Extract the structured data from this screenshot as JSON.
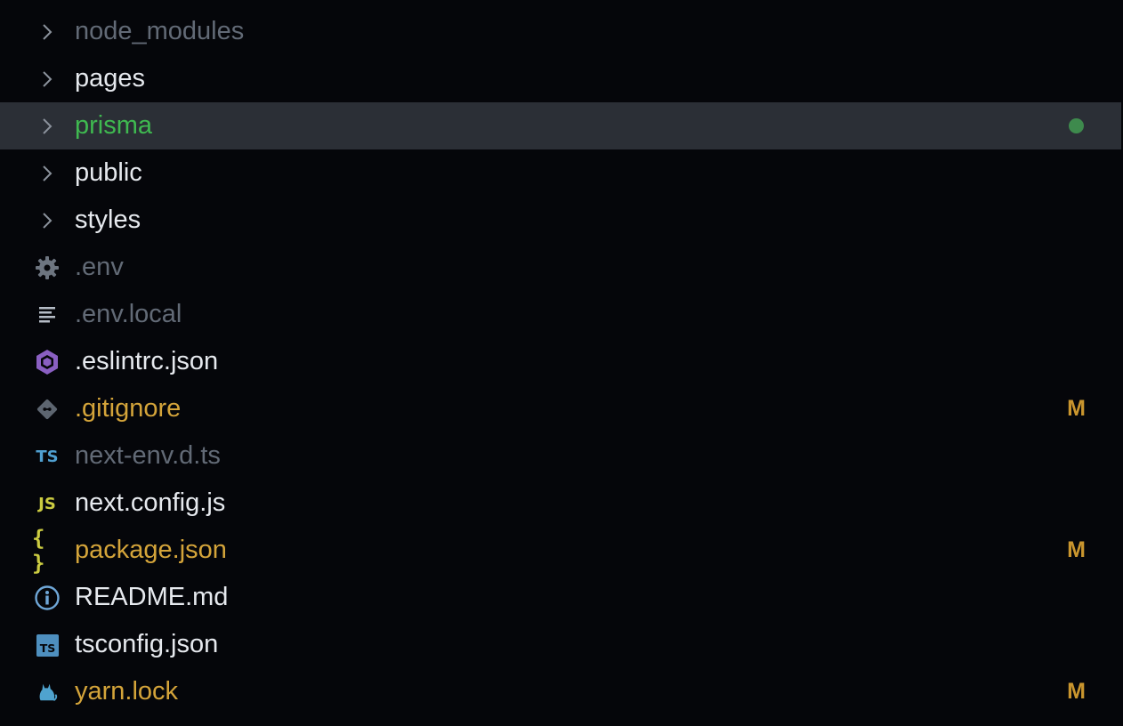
{
  "explorer": {
    "items": [
      {
        "label": "node_modules",
        "kind": "folder",
        "icon": "chevron-right-icon",
        "color": "#626a76",
        "status": ""
      },
      {
        "label": "pages",
        "kind": "folder",
        "icon": "chevron-right-icon",
        "color": "#e6e9ee",
        "status": ""
      },
      {
        "label": "prisma",
        "kind": "folder",
        "icon": "chevron-right-icon",
        "color": "#3fb950",
        "status": "dot",
        "selected": true
      },
      {
        "label": "public",
        "kind": "folder",
        "icon": "chevron-right-icon",
        "color": "#e6e9ee",
        "status": ""
      },
      {
        "label": "styles",
        "kind": "folder",
        "icon": "chevron-right-icon",
        "color": "#e6e9ee",
        "status": ""
      },
      {
        "label": ".env",
        "kind": "file",
        "icon": "gear-icon",
        "color": "#626a76",
        "status": ""
      },
      {
        "label": ".env.local",
        "kind": "file",
        "icon": "text-lines-icon",
        "color": "#626a76",
        "status": ""
      },
      {
        "label": ".eslintrc.json",
        "kind": "file",
        "icon": "eslint-icon",
        "color": "#e6e9ee",
        "status": ""
      },
      {
        "label": ".gitignore",
        "kind": "file",
        "icon": "git-icon",
        "color": "#d4a43a",
        "status": "M"
      },
      {
        "label": "next-env.d.ts",
        "kind": "file",
        "icon": "typescript-icon",
        "icon_text": "TS",
        "color": "#626a76",
        "status": ""
      },
      {
        "label": "next.config.js",
        "kind": "file",
        "icon": "javascript-icon",
        "icon_text": "JS",
        "color": "#e6e9ee",
        "status": ""
      },
      {
        "label": "package.json",
        "kind": "file",
        "icon": "json-braces-icon",
        "icon_text": "{ }",
        "color": "#d4a43a",
        "status": "M"
      },
      {
        "label": "README.md",
        "kind": "file",
        "icon": "info-icon",
        "color": "#e6e9ee",
        "status": ""
      },
      {
        "label": "tsconfig.json",
        "kind": "file",
        "icon": "tsconfig-icon",
        "icon_text": "TS",
        "color": "#e6e9ee",
        "status": ""
      },
      {
        "label": "yarn.lock",
        "kind": "file",
        "icon": "yarn-cat-icon",
        "color": "#d4a43a",
        "status": "M"
      }
    ],
    "colors": {
      "background": "#05060a",
      "selected_row": "#2b2f36",
      "modified": "#c9952e",
      "untracked_dot": "#3e8a4d"
    }
  }
}
